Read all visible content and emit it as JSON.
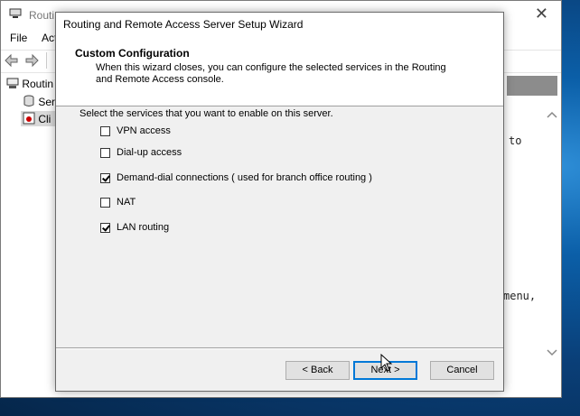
{
  "background_window": {
    "title": "Routi",
    "menu": [
      "File",
      "Act"
    ],
    "tree": [
      "Routin",
      "Ser",
      "Cli"
    ],
    "right_text_1": "to",
    "right_text_2": "menu,"
  },
  "wizard": {
    "title": "Routing and Remote Access Server Setup Wizard",
    "header_title": "Custom Configuration",
    "header_desc": "When this wizard closes, you can configure the selected services in the Routing and Remote Access console.",
    "prompt": "Select the services that you want to enable on this server.",
    "options": [
      {
        "label": "VPN access",
        "checked": false
      },
      {
        "label": "Dial-up access",
        "checked": false
      },
      {
        "label": "Demand-dial connections ( used for branch office routing )",
        "checked": true
      },
      {
        "label": "NAT",
        "checked": false
      },
      {
        "label": "LAN routing",
        "checked": true
      }
    ],
    "buttons": {
      "back": "< Back",
      "next": "Next >",
      "cancel": "Cancel"
    }
  },
  "colors": {
    "accent": "#0078d7",
    "dialog_bg": "#f0f0f0"
  }
}
